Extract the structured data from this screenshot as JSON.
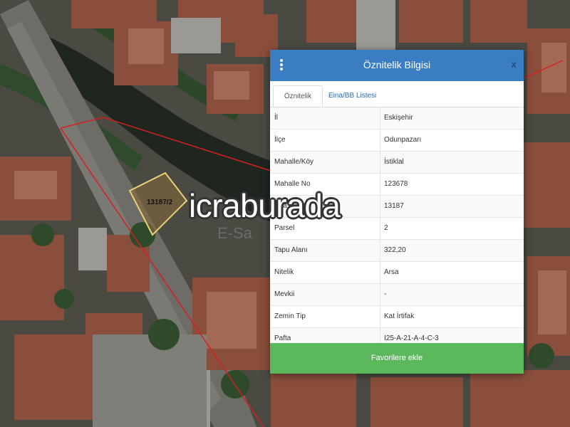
{
  "map": {
    "parcel_label": "13187/2"
  },
  "panel": {
    "title": "Öznitelik Bilgisi",
    "menu_icon": "vertical-dots-icon",
    "close_label": "x",
    "tabs": [
      {
        "label": "Öznitelik Bilgisi",
        "active": true
      },
      {
        "label": "Eina/BB Listesi",
        "active": false
      }
    ],
    "rows": [
      {
        "key": "İl",
        "value": "Eskişehir"
      },
      {
        "key": "İlçe",
        "value": "Odunpazarı"
      },
      {
        "key": "Mahalle/Köy",
        "value": "İstiklal"
      },
      {
        "key": "Mahalle No",
        "value": "123678"
      },
      {
        "key": "Ada",
        "value": "13187"
      },
      {
        "key": "Parsel",
        "value": "2"
      },
      {
        "key": "Tapu Alanı",
        "value": "322,20"
      },
      {
        "key": "Nitelik",
        "value": "Arsa"
      },
      {
        "key": "Mevkii",
        "value": "-"
      },
      {
        "key": "Zemin Tip",
        "value": "Kat İrtifak"
      },
      {
        "key": "Pafta",
        "value": "I25-A-21-A-4-C-3"
      }
    ],
    "button_label": "Favorilere ekle"
  },
  "watermark": "icraburada",
  "colors": {
    "header": "#3b7dc3",
    "button": "#5cb85c",
    "parcel_outline": "#e8d27a",
    "boundary_line": "#d42020"
  }
}
